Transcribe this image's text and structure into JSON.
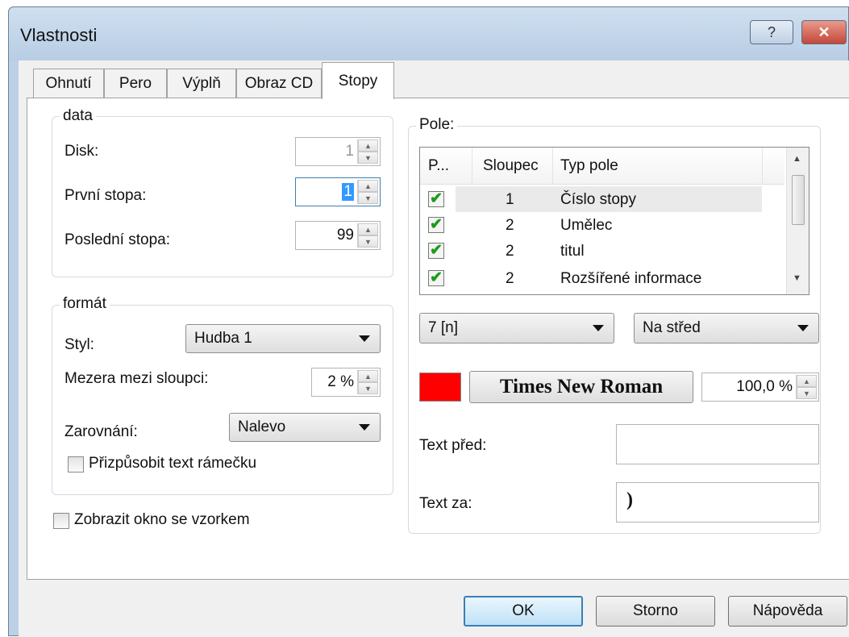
{
  "window": {
    "title": "Vlastnosti",
    "help": "?",
    "close": "✕"
  },
  "tabs": [
    "Ohnutí",
    "Pero",
    "Výplň",
    "Obraz CD",
    "Stopy"
  ],
  "data_group": {
    "title": "data",
    "disk_label": "Disk:",
    "disk_value": "1",
    "first_label": "První stopa:",
    "first_value": "1",
    "last_label": "Poslední stopa:",
    "last_value": "99"
  },
  "format_group": {
    "title": "formát",
    "style_label": "Styl:",
    "style_value": "Hudba 1",
    "gap_label": "Mezera mezi sloupci:",
    "gap_value": "2 %",
    "align_label": "Zarovnání:",
    "align_value": "Nalevo",
    "fit_label": "Přizpůsobit text rámečku"
  },
  "preview_label": "Zobrazit okno se vzorkem",
  "fields_group": {
    "title": "Pole:",
    "headers": [
      "P...",
      "Sloupec",
      "Typ pole"
    ],
    "rows": [
      {
        "checked": true,
        "column": "1",
        "type": "Číslo stopy"
      },
      {
        "checked": true,
        "column": "2",
        "type": "Umělec"
      },
      {
        "checked": true,
        "column": "2",
        "type": "titul"
      },
      {
        "checked": true,
        "column": "2",
        "type": "Rozšířené informace"
      }
    ],
    "format_value": "7 [n]",
    "position_value": "Na střed",
    "color": "#ff0000",
    "font_label": "Times New Roman",
    "size_value": "100,0 %",
    "before_label": "Text před:",
    "before_value": "",
    "after_label": "Text za:",
    "after_value": ")"
  },
  "buttons": {
    "ok": "OK",
    "cancel": "Storno",
    "help": "Nápověda"
  }
}
